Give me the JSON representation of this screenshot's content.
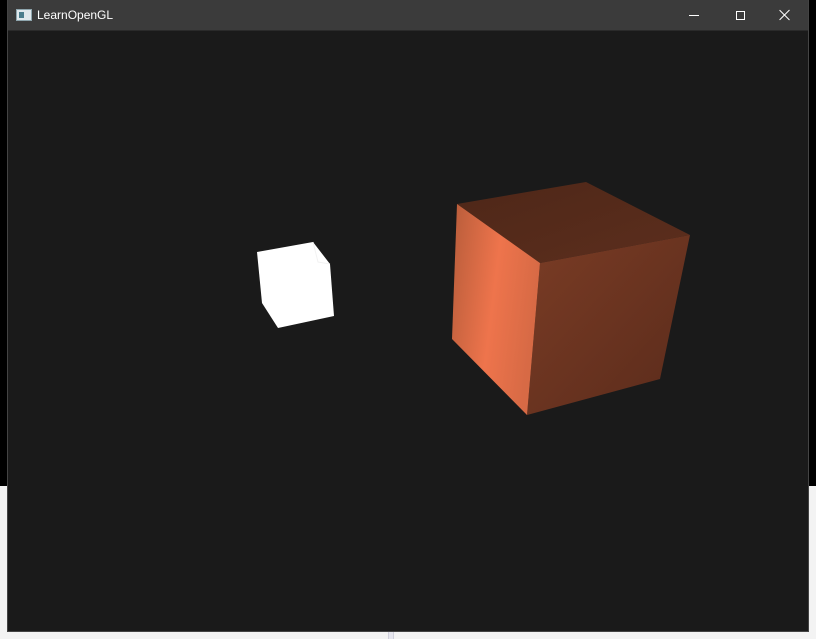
{
  "window": {
    "title": "LearnOpenGL",
    "app_icon": "opengl-app-icon",
    "controls": {
      "minimize_icon": "minimize-icon",
      "maximize_icon": "maximize-icon",
      "close_icon": "close-icon"
    }
  },
  "scene": {
    "background_color": "#1a1a1a",
    "objects": [
      {
        "name": "light-source-cube",
        "color": "#ffffff"
      },
      {
        "name": "lit-object-cube",
        "color": "#ff7f50"
      }
    ]
  }
}
